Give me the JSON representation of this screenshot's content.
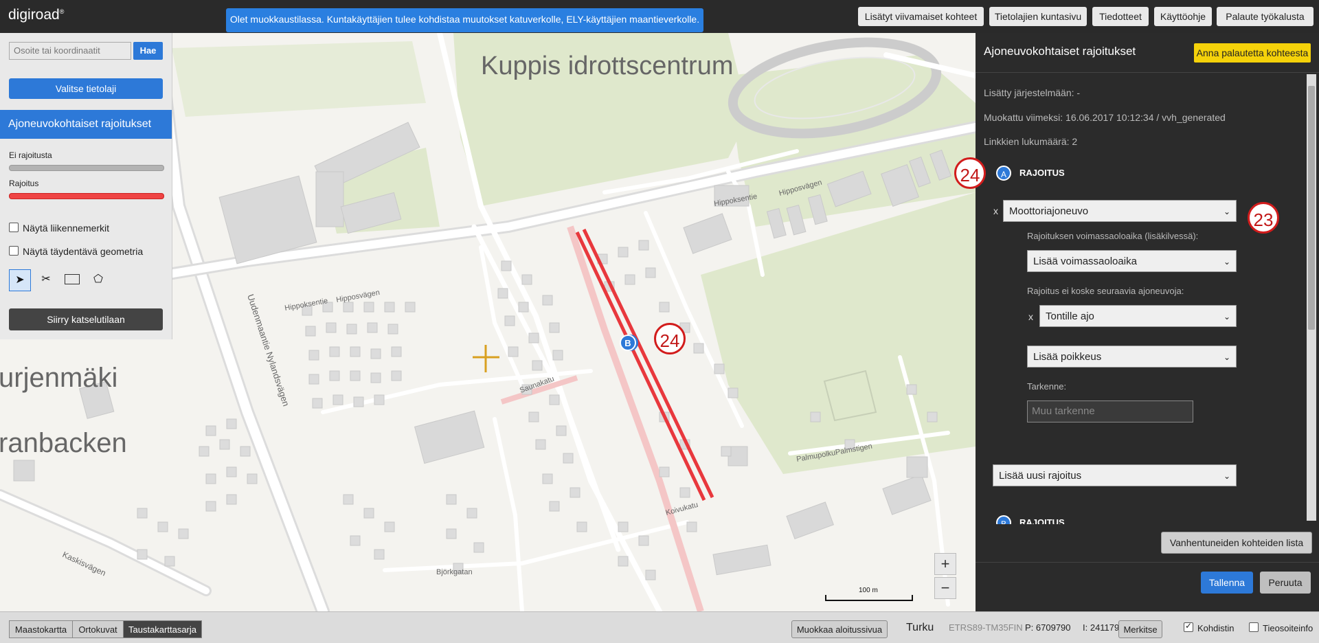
{
  "app": {
    "logo": "digiroad",
    "edit_notice": "Olet muokkaustilassa. Kuntakäyttäjien tulee kohdistaa muutokset katuverkolle, ELY-käyttäjien maantieverkolle."
  },
  "topnav": {
    "items": [
      "Lisätyt viivamaiset kohteet",
      "Tietolajien kuntasivu",
      "Tiedotteet",
      "Käyttöohje",
      "Palaute työkalusta"
    ]
  },
  "search": {
    "placeholder": "Osoite tai koordinaatit",
    "button": "Hae"
  },
  "left_panel": {
    "select_layer": "Valitse tietolaji",
    "layer_title": "Ajoneuvokohtaiset rajoitukset",
    "legend": [
      {
        "label": "Ei rajoitusta",
        "color": "#b3b3b3"
      },
      {
        "label": "Rajoitus",
        "color": "#ef4444"
      }
    ],
    "checkboxes": [
      "Näytä liikennemerkit",
      "Näytä täydentävä geometria"
    ],
    "view_mode_button": "Siirry katselutilaan"
  },
  "map": {
    "labels": {
      "kuppis": "Kuppis idrottscentrum",
      "kurjenmaki": "urjenmäki",
      "branbacken": "ranbacken",
      "hippoksentie": "Hippoksentie",
      "hipposvagen": "Hipposvägen",
      "uudenmaantie": "Uudenmaantie Nylandsvägen",
      "kaskisvagen": "Kaskisvägen",
      "saunakatu": "Saunakatu",
      "bjorkgatan": "Björkgatan",
      "koivukatu": "Koivukatu",
      "palmupolku": "PalmupolkuPalmstigen",
      "scale": "100 m"
    },
    "marker_letter": "B",
    "zoom_in": "+",
    "zoom_out": "−"
  },
  "right_panel": {
    "title": "Ajoneuvokohtaiset rajoitukset",
    "feedback_button": "Anna palautetta kohteesta",
    "added": "Lisätty järjestelmään: -",
    "modified": "Muokattu viimeksi: 16.06.2017 10:12:34 / vvh_generated",
    "link_count": "Linkkien lukumäärä: 2",
    "section_a": {
      "letter": "A",
      "heading": "RAJOITUS"
    },
    "remove_x": "x",
    "vehicle_select": "Moottoriajoneuvo",
    "validity_label": "Rajoituksen voimassaoloaika (lisäkilvessä):",
    "validity_select": "Lisää voimassaoloaika",
    "exception_label": "Rajoitus ei koske seuraavia ajoneuvoja:",
    "exception_select": "Tontille ajo",
    "add_exception": "Lisää poikkeus",
    "spec_label": "Tarkenne:",
    "spec_placeholder": "Muu tarkenne",
    "add_restriction": "Lisää uusi rajoitus",
    "section_b": {
      "letter": "B",
      "heading": "RAJOITUS"
    },
    "expired_button": "Vanhentuneiden kohteiden lista",
    "save": "Tallenna",
    "cancel": "Peruuta"
  },
  "annotations": [
    "24",
    "23",
    "24"
  ],
  "bottombar": {
    "basemaps": [
      "Maastokartta",
      "Ortokuvat",
      "Taustakarttasarja"
    ],
    "edit_start_page": "Muokkaa aloitussivua",
    "municipality": "Turku",
    "crs": "ETRS89-TM35FIN",
    "p_coord": "P: 6709790",
    "i_coord": "I: 241179",
    "mark_button": "Merkitse",
    "kohdistin": "Kohdistin",
    "tieosoiteinfo": "Tieosoiteinfo"
  }
}
